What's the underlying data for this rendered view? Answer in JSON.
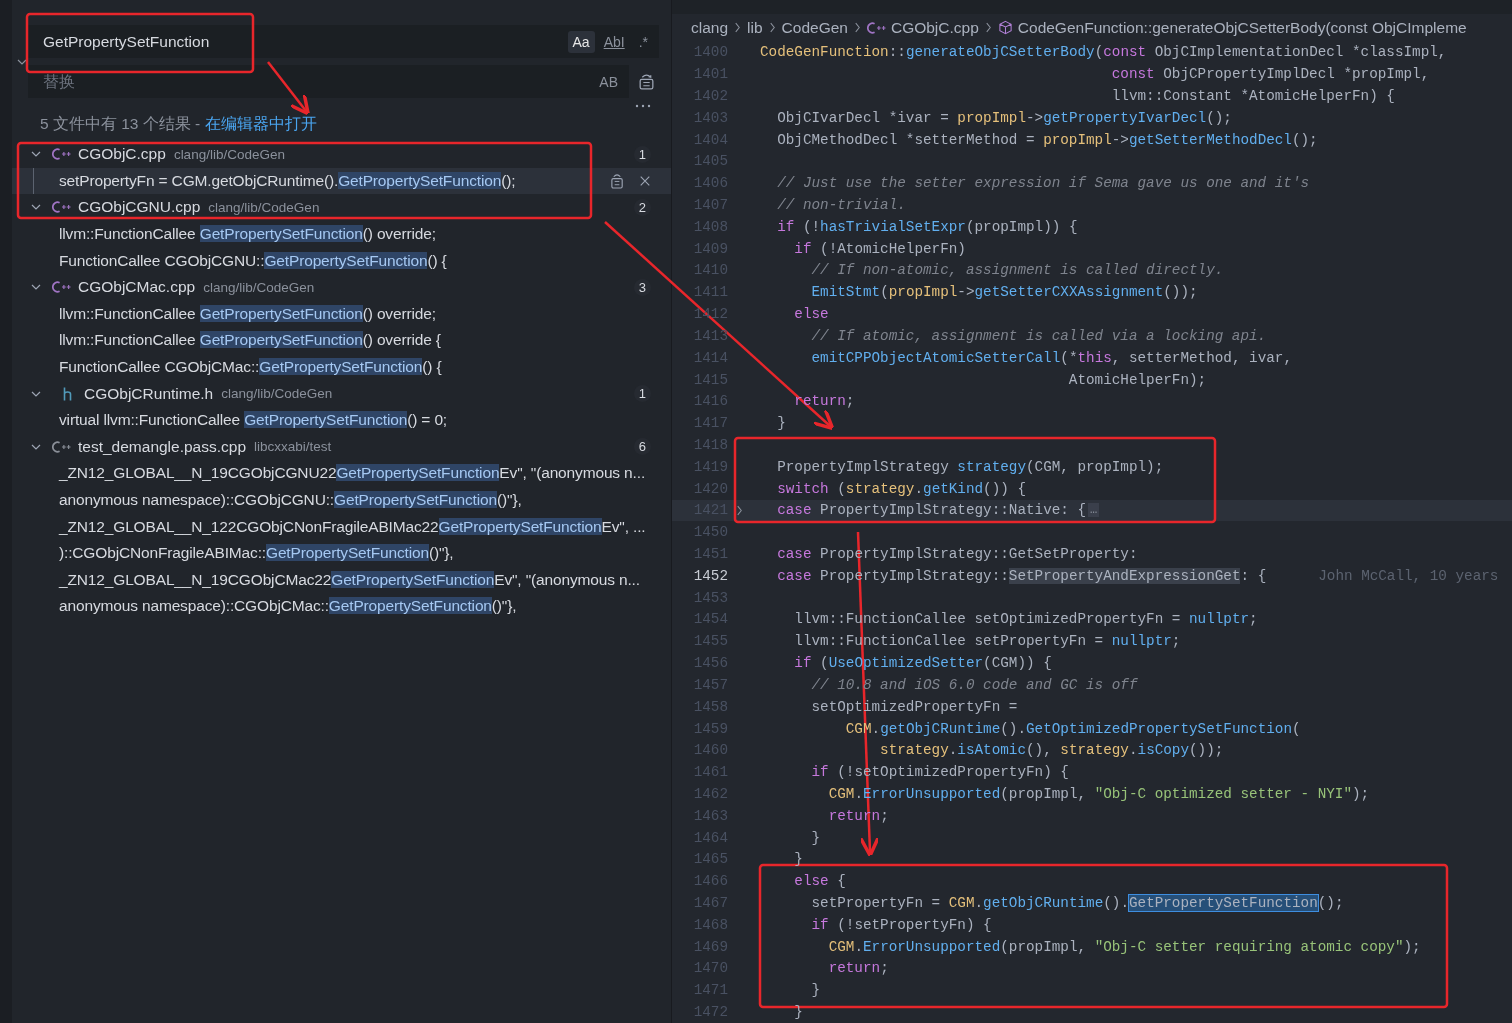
{
  "search": {
    "query": "GetPropertySetFunction",
    "replace_expanded": true,
    "options": [
      {
        "label": "Aa",
        "selected": true
      },
      {
        "label": "AbI",
        "selected": false
      },
      {
        "label": ".*",
        "selected": false
      }
    ],
    "replace_placeholder": "替换",
    "replace_option": {
      "label": "AB",
      "selected": false
    }
  },
  "summary": {
    "text": "5 文件中有 13 个结果 - ",
    "link": "在编辑器中打开"
  },
  "results": [
    {
      "kind": "cpp",
      "color": "#a074c4",
      "name": "CGObjC.cpp",
      "path": "clang/lib/CodeGen",
      "count": "1",
      "expanded": true,
      "matches": [
        {
          "before": "setPropertyFn = CGM.getObjCRuntime().",
          "match": "GetPropertySetFunction",
          "after": "();",
          "selected": true
        }
      ]
    },
    {
      "kind": "cpp",
      "color": "#a074c4",
      "name": "CGObjCGNU.cpp",
      "path": "clang/lib/CodeGen",
      "count": "2",
      "expanded": true,
      "matches": [
        {
          "before": "llvm::FunctionCallee ",
          "match": "GetPropertySetFunction",
          "after": "() override;",
          "selected": false
        },
        {
          "before": "FunctionCallee CGObjCGNU::",
          "match": "GetPropertySetFunction",
          "after": "() {",
          "selected": false
        }
      ]
    },
    {
      "kind": "cpp",
      "color": "#a074c4",
      "name": "CGObjCMac.cpp",
      "path": "clang/lib/CodeGen",
      "count": "3",
      "expanded": true,
      "matches": [
        {
          "before": "llvm::FunctionCallee ",
          "match": "GetPropertySetFunction",
          "after": "() override;",
          "selected": false
        },
        {
          "before": "llvm::FunctionCallee ",
          "match": "GetPropertySetFunction",
          "after": "() override {",
          "selected": false
        },
        {
          "before": "FunctionCallee CGObjCMac::",
          "match": "GetPropertySetFunction",
          "after": "() {",
          "selected": false
        }
      ]
    },
    {
      "kind": "h",
      "color": "#519aba",
      "name": "CGObjCRuntime.h",
      "path": "clang/lib/CodeGen",
      "count": "1",
      "expanded": true,
      "matches": [
        {
          "before": "virtual llvm::FunctionCallee ",
          "match": "GetPropertySetFunction",
          "after": "() = 0;",
          "selected": false
        }
      ]
    },
    {
      "kind": "cpp",
      "color": "#8a8f98",
      "name": "test_demangle.pass.cpp",
      "path": "libcxxabi/test",
      "count": "6",
      "expanded": true,
      "matches": [
        {
          "before": "_ZN12_GLOBAL__N_19CGObjCGNU22",
          "match": "GetPropertySetFunction",
          "after": "Ev\", \"(anonymous n...",
          "selected": false
        },
        {
          "before": "anonymous namespace)::CGObjCGNU::",
          "match": "GetPropertySetFunction",
          "after": "()\"},",
          "selected": false
        },
        {
          "before": "_ZN12_GLOBAL__N_122CGObjCNonFragileABIMac22",
          "match": "GetPropertySetFunction",
          "after": "Ev\", ...",
          "selected": false
        },
        {
          "before": ")::CGObjCNonFragileABIMac::",
          "match": "GetPropertySetFunction",
          "after": "()\"},",
          "selected": false
        },
        {
          "before": "_ZN12_GLOBAL__N_19CGObjCMac22",
          "match": "GetPropertySetFunction",
          "after": "Ev\", \"(anonymous n...",
          "selected": false
        },
        {
          "before": "anonymous namespace)::CGObjCMac::",
          "match": "GetPropertySetFunction",
          "after": "()\"},",
          "selected": false
        }
      ]
    }
  ],
  "editor": {
    "breadcrumb": [
      {
        "kind": "folder",
        "label": "clang"
      },
      {
        "kind": "folder",
        "label": "lib"
      },
      {
        "kind": "folder",
        "label": "CodeGen"
      },
      {
        "kind": "file",
        "label": "CGObjC.cpp"
      },
      {
        "kind": "symbol",
        "label": "CodeGenFunction::generateObjCSetterBody(const ObjCImpleme"
      }
    ],
    "lines": [
      {
        "number": "1400",
        "current": false,
        "folded": false,
        "tokens": [
          {
            "text": "CodeGenFunction",
            "kind": "ty"
          },
          {
            "text": "::",
            "kind": "p"
          },
          {
            "text": "generateObjCSetterBody",
            "kind": "fn"
          },
          {
            "text": "(",
            "kind": "p"
          },
          {
            "text": "const",
            "kind": "kw"
          },
          {
            "text": " ObjCImplementationDecl *classImpl,",
            "kind": "p"
          }
        ]
      },
      {
        "number": "1401",
        "current": false,
        "folded": false,
        "tokens": [
          {
            "text": "                                         const",
            "kind": "kw"
          },
          {
            "text": " ObjCPropertyImplDecl *propImpl,",
            "kind": "p"
          }
        ]
      },
      {
        "number": "1402",
        "current": false,
        "folded": false,
        "tokens": [
          {
            "text": "                                         llvm::Constant *AtomicHelperFn) {",
            "kind": "p"
          }
        ]
      },
      {
        "number": "1403",
        "current": false,
        "folded": false,
        "tokens": [
          {
            "text": "  ObjCIvarDecl *ivar = ",
            "kind": "p"
          },
          {
            "text": "propImpl",
            "kind": "ty"
          },
          {
            "text": "->",
            "kind": "p"
          },
          {
            "text": "getPropertyIvarDecl",
            "kind": "fn"
          },
          {
            "text": "();",
            "kind": "p"
          }
        ]
      },
      {
        "number": "1404",
        "current": false,
        "folded": false,
        "tokens": [
          {
            "text": "  ObjCMethodDecl *setterMethod = ",
            "kind": "p"
          },
          {
            "text": "propImpl",
            "kind": "ty"
          },
          {
            "text": "->",
            "kind": "p"
          },
          {
            "text": "getSetterMethodDecl",
            "kind": "fn"
          },
          {
            "text": "();",
            "kind": "p"
          }
        ]
      },
      {
        "number": "1405",
        "current": false,
        "folded": false
      },
      {
        "number": "1406",
        "current": false,
        "folded": false,
        "tokens": [
          {
            "text": "  // Just use the setter expression if Sema gave us one and it's",
            "kind": "cm"
          }
        ]
      },
      {
        "number": "1407",
        "current": false,
        "folded": false,
        "tokens": [
          {
            "text": "  // non-trivial.",
            "kind": "cm"
          }
        ]
      },
      {
        "number": "1408",
        "current": false,
        "folded": false,
        "tokens": [
          {
            "text": "  if",
            "kind": "kw"
          },
          {
            "text": " (!",
            "kind": "p"
          },
          {
            "text": "hasTrivialSetExpr",
            "kind": "fn"
          },
          {
            "text": "(propImpl)) {",
            "kind": "p"
          }
        ]
      },
      {
        "number": "1409",
        "current": false,
        "folded": false,
        "tokens": [
          {
            "text": "    if",
            "kind": "kw"
          },
          {
            "text": " (!AtomicHelperFn)",
            "kind": "p"
          }
        ]
      },
      {
        "number": "1410",
        "current": false,
        "folded": false,
        "tokens": [
          {
            "text": "      // If non-atomic, assignment is called directly.",
            "kind": "cm"
          }
        ]
      },
      {
        "number": "1411",
        "current": false,
        "folded": false,
        "tokens": [
          {
            "text": "      EmitStmt",
            "kind": "fn"
          },
          {
            "text": "(",
            "kind": "p"
          },
          {
            "text": "propImpl",
            "kind": "ty"
          },
          {
            "text": "->",
            "kind": "p"
          },
          {
            "text": "getSetterCXXAssignment",
            "kind": "fn"
          },
          {
            "text": "());",
            "kind": "p"
          }
        ]
      },
      {
        "number": "1412",
        "current": false,
        "folded": false,
        "tokens": [
          {
            "text": "    else",
            "kind": "kw"
          }
        ]
      },
      {
        "number": "1413",
        "current": false,
        "folded": false,
        "tokens": [
          {
            "text": "      // If atomic, assignment is called via a locking api.",
            "kind": "cm"
          }
        ]
      },
      {
        "number": "1414",
        "current": false,
        "folded": false,
        "tokens": [
          {
            "text": "      emitCPPObjectAtomicSetterCall",
            "kind": "fn"
          },
          {
            "text": "(*",
            "kind": "p"
          },
          {
            "text": "this",
            "kind": "kw"
          },
          {
            "text": ", setterMethod, ivar,",
            "kind": "p"
          }
        ]
      },
      {
        "number": "1415",
        "current": false,
        "folded": false,
        "tokens": [
          {
            "text": "                                    AtomicHelperFn);",
            "kind": "p"
          }
        ]
      },
      {
        "number": "1416",
        "current": false,
        "folded": false,
        "tokens": [
          {
            "text": "    return",
            "kind": "kw"
          },
          {
            "text": ";",
            "kind": "p"
          }
        ]
      },
      {
        "number": "1417",
        "current": false,
        "folded": false,
        "tokens": [
          {
            "text": "  }",
            "kind": "p"
          }
        ]
      },
      {
        "number": "1418",
        "current": false,
        "folded": false
      },
      {
        "number": "1419",
        "current": false,
        "folded": false,
        "tokens": [
          {
            "text": "  PropertyImplStrategy ",
            "kind": "p"
          },
          {
            "text": "strategy",
            "kind": "fn"
          },
          {
            "text": "(CGM, propImpl);",
            "kind": "p"
          }
        ]
      },
      {
        "number": "1420",
        "current": false,
        "folded": false,
        "tokens": [
          {
            "text": "  switch",
            "kind": "kw"
          },
          {
            "text": " (",
            "kind": "p"
          },
          {
            "text": "strategy",
            "kind": "ty"
          },
          {
            "text": ".",
            "kind": "p"
          },
          {
            "text": "getKind",
            "kind": "fn"
          },
          {
            "text": "()) {",
            "kind": "p"
          }
        ]
      },
      {
        "number": "1421",
        "current": false,
        "folded": true,
        "fold_marker": "…",
        "tokens": [
          {
            "text": "  case",
            "kind": "kw"
          },
          {
            "text": " PropertyImplStrategy::Native: {",
            "kind": "p"
          }
        ]
      },
      {
        "number": "1450",
        "current": false,
        "folded": false
      },
      {
        "number": "1451",
        "current": false,
        "folded": false,
        "tokens": [
          {
            "text": "  case",
            "kind": "kw"
          },
          {
            "text": " PropertyImplStrategy::GetSetProperty:",
            "kind": "p"
          }
        ]
      },
      {
        "number": "1452",
        "current": true,
        "folded": false,
        "blame": "John McCall, 10 years",
        "tokens": [
          {
            "text": "  case",
            "kind": "kw"
          },
          {
            "text": " PropertyImplStrategy::",
            "kind": "p"
          },
          {
            "text": "SetPropertyAndExpressionGet",
            "kind": "occ"
          },
          {
            "text": ": {",
            "kind": "p"
          }
        ]
      },
      {
        "number": "1453",
        "current": false,
        "folded": false
      },
      {
        "number": "1454",
        "current": false,
        "folded": false,
        "tokens": [
          {
            "text": "    llvm::FunctionCallee setOptimizedPropertyFn = ",
            "kind": "p"
          },
          {
            "text": "nullptr",
            "kind": "fn"
          },
          {
            "text": ";",
            "kind": "p"
          }
        ]
      },
      {
        "number": "1455",
        "current": false,
        "folded": false,
        "tokens": [
          {
            "text": "    llvm::FunctionCallee setPropertyFn = ",
            "kind": "p"
          },
          {
            "text": "nullptr",
            "kind": "fn"
          },
          {
            "text": ";",
            "kind": "p"
          }
        ]
      },
      {
        "number": "1456",
        "current": false,
        "folded": false,
        "tokens": [
          {
            "text": "    if",
            "kind": "kw"
          },
          {
            "text": " (",
            "kind": "p"
          },
          {
            "text": "UseOptimizedSetter",
            "kind": "fn"
          },
          {
            "text": "(CGM)) {",
            "kind": "p"
          }
        ]
      },
      {
        "number": "1457",
        "current": false,
        "folded": false,
        "tokens": [
          {
            "text": "      // 10.8 and iOS 6.0 code and GC is off",
            "kind": "cm"
          }
        ]
      },
      {
        "number": "1458",
        "current": false,
        "folded": false,
        "tokens": [
          {
            "text": "      setOptimizedPropertyFn =",
            "kind": "p"
          }
        ]
      },
      {
        "number": "1459",
        "current": false,
        "folded": false,
        "tokens": [
          {
            "text": "          CGM",
            "kind": "ty"
          },
          {
            "text": ".",
            "kind": "p"
          },
          {
            "text": "getObjCRuntime",
            "kind": "fn"
          },
          {
            "text": "().",
            "kind": "p"
          },
          {
            "text": "GetOptimizedPropertySetFunction",
            "kind": "fn"
          },
          {
            "text": "(",
            "kind": "p"
          }
        ]
      },
      {
        "number": "1460",
        "current": false,
        "folded": false,
        "tokens": [
          {
            "text": "              strategy",
            "kind": "ty"
          },
          {
            "text": ".",
            "kind": "p"
          },
          {
            "text": "isAtomic",
            "kind": "fn"
          },
          {
            "text": "(), ",
            "kind": "p"
          },
          {
            "text": "strategy",
            "kind": "ty"
          },
          {
            "text": ".",
            "kind": "p"
          },
          {
            "text": "isCopy",
            "kind": "fn"
          },
          {
            "text": "());",
            "kind": "p"
          }
        ]
      },
      {
        "number": "1461",
        "current": false,
        "folded": false,
        "tokens": [
          {
            "text": "      if",
            "kind": "kw"
          },
          {
            "text": " (!setOptimizedPropertyFn) {",
            "kind": "p"
          }
        ]
      },
      {
        "number": "1462",
        "current": false,
        "folded": false,
        "tokens": [
          {
            "text": "        CGM",
            "kind": "ty"
          },
          {
            "text": ".",
            "kind": "p"
          },
          {
            "text": "ErrorUnsupported",
            "kind": "fn"
          },
          {
            "text": "(propImpl, ",
            "kind": "p"
          },
          {
            "text": "\"Obj-C optimized setter - NYI\"",
            "kind": "str"
          },
          {
            "text": ");",
            "kind": "p"
          }
        ]
      },
      {
        "number": "1463",
        "current": false,
        "folded": false,
        "tokens": [
          {
            "text": "        return",
            "kind": "kw"
          },
          {
            "text": ";",
            "kind": "p"
          }
        ]
      },
      {
        "number": "1464",
        "current": false,
        "folded": false,
        "tokens": [
          {
            "text": "      }",
            "kind": "p"
          }
        ]
      },
      {
        "number": "1465",
        "current": false,
        "folded": false,
        "tokens": [
          {
            "text": "    }",
            "kind": "p"
          }
        ]
      },
      {
        "number": "1466",
        "current": false,
        "folded": false,
        "tokens": [
          {
            "text": "    else",
            "kind": "kw"
          },
          {
            "text": " {",
            "kind": "p"
          }
        ]
      },
      {
        "number": "1467",
        "current": false,
        "folded": false,
        "tokens": [
          {
            "text": "      setPropertyFn = ",
            "kind": "p"
          },
          {
            "text": "CGM",
            "kind": "ty"
          },
          {
            "text": ".",
            "kind": "p"
          },
          {
            "text": "getObjCRuntime",
            "kind": "fn"
          },
          {
            "text": "().",
            "kind": "p"
          },
          {
            "text": "GetPropertySetFunction",
            "kind": "sel"
          },
          {
            "text": "();",
            "kind": "p"
          }
        ]
      },
      {
        "number": "1468",
        "current": false,
        "folded": false,
        "tokens": [
          {
            "text": "      if",
            "kind": "kw"
          },
          {
            "text": " (!setPropertyFn) {",
            "kind": "p"
          }
        ]
      },
      {
        "number": "1469",
        "current": false,
        "folded": false,
        "tokens": [
          {
            "text": "        CGM",
            "kind": "ty"
          },
          {
            "text": ".",
            "kind": "p"
          },
          {
            "text": "ErrorUnsupported",
            "kind": "fn"
          },
          {
            "text": "(propImpl, ",
            "kind": "p"
          },
          {
            "text": "\"Obj-C setter requiring atomic copy\"",
            "kind": "str"
          },
          {
            "text": ");",
            "kind": "p"
          }
        ]
      },
      {
        "number": "1470",
        "current": false,
        "folded": false,
        "tokens": [
          {
            "text": "        return",
            "kind": "kw"
          },
          {
            "text": ";",
            "kind": "p"
          }
        ]
      },
      {
        "number": "1471",
        "current": false,
        "folded": false,
        "tokens": [
          {
            "text": "      }",
            "kind": "p"
          }
        ]
      },
      {
        "number": "1472",
        "current": false,
        "folded": false,
        "tokens": [
          {
            "text": "    }",
            "kind": "p"
          }
        ]
      }
    ]
  }
}
